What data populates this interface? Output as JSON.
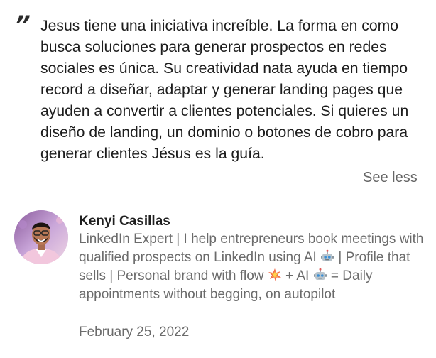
{
  "recommendation": {
    "quote_mark": "”",
    "text": "Jesus tiene una iniciativa increíble. La forma en como busca soluciones para generar prospectos en redes sociales es única. Su creatividad nata ayuda en tiempo record a diseñar, adaptar y generar landing pages que ayuden a convertir a clientes potenciales. Si quieres un diseño de landing, un dominio o botones de cobro para generar clientes Jésus es la guía.",
    "see_less_label": "See less"
  },
  "author": {
    "name": "Kenyi Casillas",
    "headline": {
      "part1": "LinkedIn Expert | I help entrepreneurs book meetings with qualified prospects on LinkedIn using AI ",
      "part2": " | Profile that sells | Personal brand with flow ",
      "part3": " + AI ",
      "part4": " = Daily appointments without begging, on autopilot"
    },
    "icons": [
      "robot-emoji-icon",
      "collision-emoji-icon",
      "robot-emoji-icon"
    ],
    "date": "February 25, 2022"
  }
}
